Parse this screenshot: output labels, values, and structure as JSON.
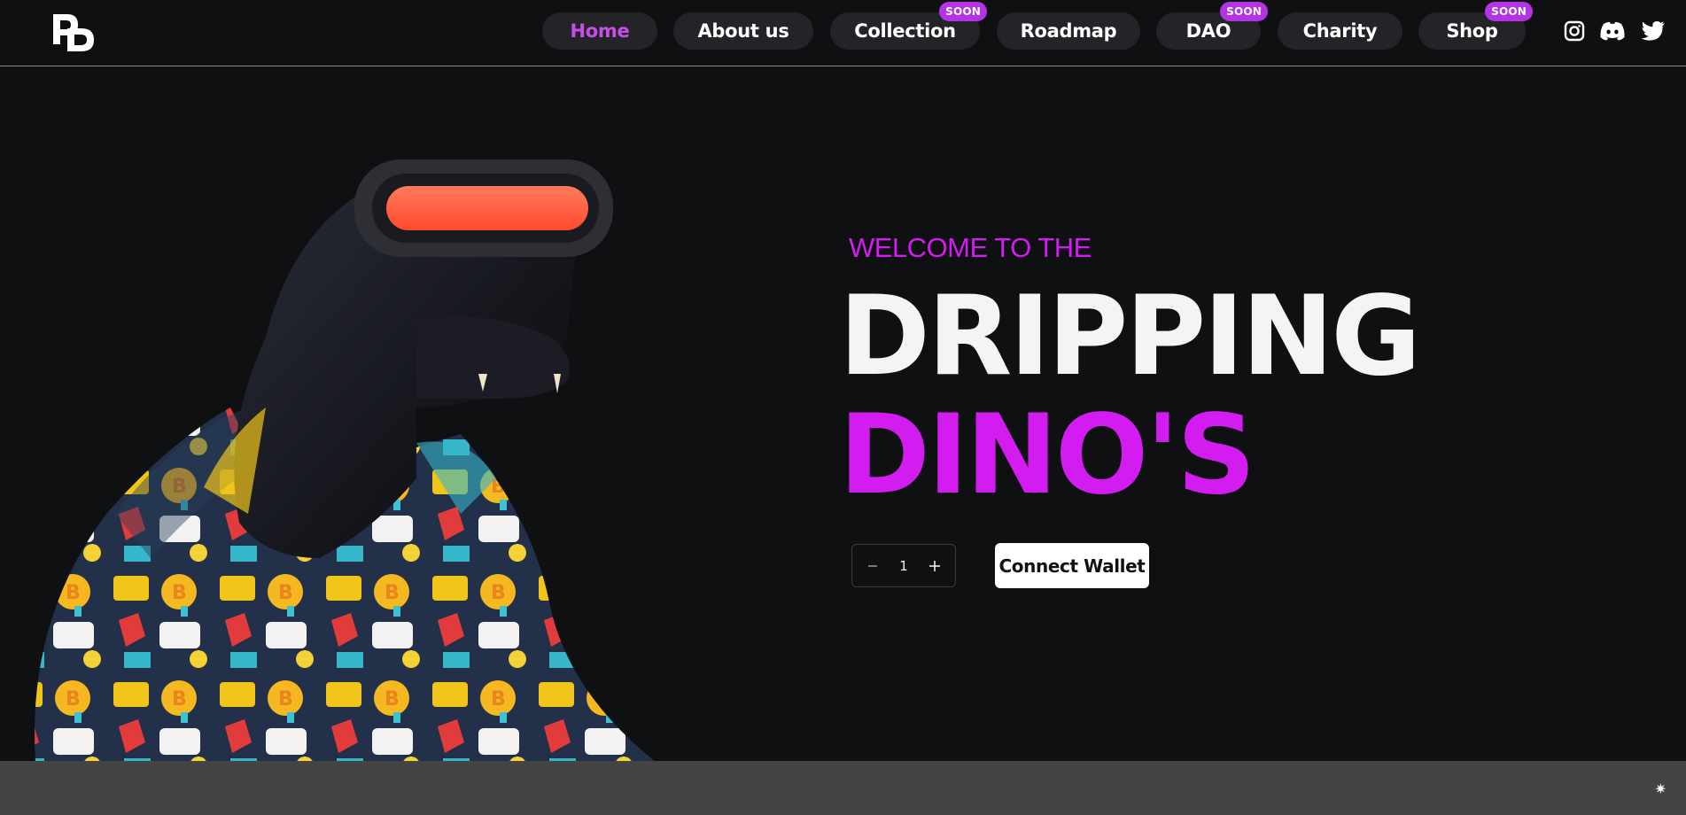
{
  "header": {
    "logo_letters": "DD",
    "nav": [
      {
        "label": "Home",
        "active": true,
        "badge": ""
      },
      {
        "label": "About us",
        "active": false,
        "badge": ""
      },
      {
        "label": "Collection",
        "active": false,
        "badge": "SOON"
      },
      {
        "label": "Roadmap",
        "active": false,
        "badge": ""
      },
      {
        "label": "DAO",
        "active": false,
        "badge": "SOON"
      },
      {
        "label": "Charity",
        "active": false,
        "badge": ""
      },
      {
        "label": "Shop",
        "active": false,
        "badge": "SOON"
      }
    ],
    "socials": [
      "instagram-icon",
      "discord-icon",
      "twitter-icon"
    ]
  },
  "hero": {
    "welcome": "WELCOME TO THE",
    "title_line1": "DRIPPING",
    "title_line2": "DINO'S",
    "quantity": "1",
    "connect_label": "Connect Wallet"
  },
  "colors": {
    "accent": "#d21cf0",
    "badge": "#b433e4",
    "background": "#0f1012",
    "pill": "#232427",
    "bottom_bar": "#444444"
  },
  "bottom_bar": {
    "icon": "sparkle-icon"
  }
}
